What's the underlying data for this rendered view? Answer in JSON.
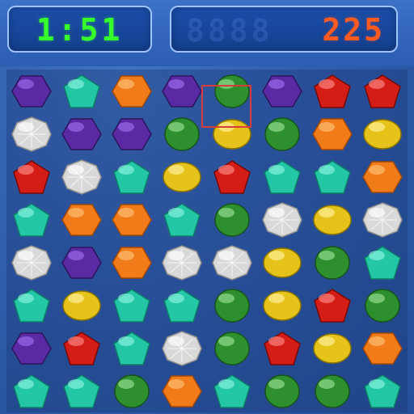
{
  "hud": {
    "timer": "1:51",
    "score": "225",
    "score_ghost": "8888"
  },
  "selection": {
    "row": 2,
    "col": 4
  },
  "board": [
    [
      "purple",
      "teal",
      "orange",
      "purple",
      "green",
      "purple",
      "red",
      "red"
    ],
    [
      "white",
      "purple",
      "purple",
      "green",
      "yellow",
      "green",
      "orange",
      "yellow"
    ],
    [
      "red",
      "white",
      "teal",
      "yellow",
      "red",
      "teal",
      "teal",
      "orange"
    ],
    [
      "teal",
      "orange",
      "orange",
      "teal",
      "green",
      "white",
      "yellow",
      "white"
    ],
    [
      "white",
      "purple",
      "orange",
      "white",
      "white",
      "yellow",
      "green",
      "teal"
    ],
    [
      "teal",
      "yellow",
      "teal",
      "teal",
      "green",
      "yellow",
      "red",
      "green"
    ],
    [
      "purple",
      "red",
      "teal",
      "white",
      "green",
      "red",
      "yellow",
      "orange"
    ],
    [
      "teal",
      "teal",
      "green",
      "orange",
      "teal",
      "green",
      "green",
      "teal"
    ]
  ],
  "gem_styles": {
    "purple": {
      "color": "#5a2aa3",
      "highlight": "#a06ff0",
      "shadow": "#2d145e",
      "shape": "hexagon"
    },
    "teal": {
      "color": "#23c7a5",
      "highlight": "#8ff6e2",
      "shadow": "#0c7c68",
      "shape": "pentagon"
    },
    "orange": {
      "color": "#f07b18",
      "highlight": "#ffc27a",
      "shadow": "#a24708",
      "shape": "hexagon"
    },
    "green": {
      "color": "#2e8f2e",
      "highlight": "#9be095",
      "shadow": "#175417",
      "shape": "circle"
    },
    "red": {
      "color": "#d51d17",
      "highlight": "#ff8b86",
      "shadow": "#780905",
      "shape": "pentagon"
    },
    "yellow": {
      "color": "#e5c31b",
      "highlight": "#fff19f",
      "shadow": "#8b7400",
      "shape": "oval"
    },
    "white": {
      "color": "#d9d9d9",
      "highlight": "#ffffff",
      "shadow": "#8d8d8d",
      "shape": "diamond"
    }
  }
}
